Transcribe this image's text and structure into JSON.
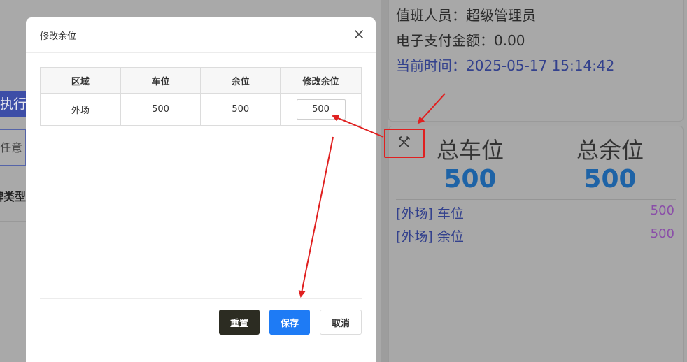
{
  "background": {
    "exec_button_label": "执行",
    "filter_placeholder": "任意",
    "plate_type_label": "牌类型",
    "info": {
      "duty_staff": "值班人员：超级管理员",
      "epay_amount": "电子支付金额：0.00",
      "current_time": "当前时间：2025-05-17 15:14:42"
    },
    "stats": {
      "total_spaces_label": "总车位",
      "total_spaces_value": "500",
      "total_free_label": "总余位",
      "total_free_value": "500"
    },
    "zones": [
      {
        "label": "[外场] 车位",
        "value": "500"
      },
      {
        "label": "[外场] 余位",
        "value": "500"
      }
    ]
  },
  "modal": {
    "title": "修改余位",
    "columns": [
      "区域",
      "车位",
      "余位",
      "修改余位"
    ],
    "rows": [
      {
        "zone": "外场",
        "spaces": "500",
        "free": "500",
        "edit_value": "500"
      }
    ],
    "buttons": {
      "reset": "重置",
      "save": "保存",
      "cancel": "取消"
    }
  },
  "colors": {
    "accent_blue": "#1e7bf5",
    "reset_dark": "#2c2c22",
    "annotation_red": "#e02020",
    "stat_blue": "#1e63a6"
  },
  "icons": {
    "close": "close-icon",
    "tools": "tools-icon"
  }
}
